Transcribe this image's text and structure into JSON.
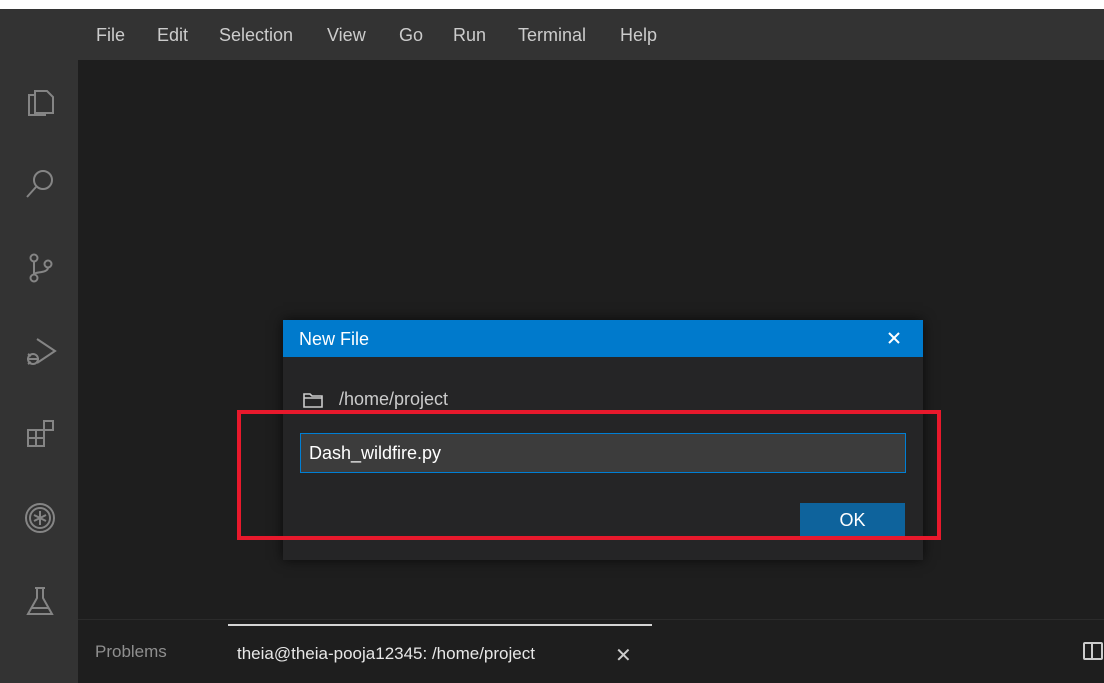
{
  "menubar": {
    "items": [
      "File",
      "Edit",
      "Selection",
      "View",
      "Go",
      "Run",
      "Terminal",
      "Help"
    ]
  },
  "activity_bar": {
    "icons": [
      "explorer-icon",
      "search-icon",
      "source-control-icon",
      "run-debug-icon",
      "extensions-icon",
      "plugin-icon",
      "testing-icon"
    ]
  },
  "dialog": {
    "title": "New File",
    "path": "/home/project",
    "input_value": "Dash_wildfire.py",
    "ok_label": "OK"
  },
  "panel": {
    "problems_label": "Problems",
    "terminal_label": "theia@theia-pooja12345: /home/project",
    "close_glyph": "✕"
  },
  "colors": {
    "accent": "#007acc",
    "button": "#0e639c",
    "annotation": "#e8192c",
    "background": "#1e1e1e",
    "sidebar": "#333333"
  }
}
